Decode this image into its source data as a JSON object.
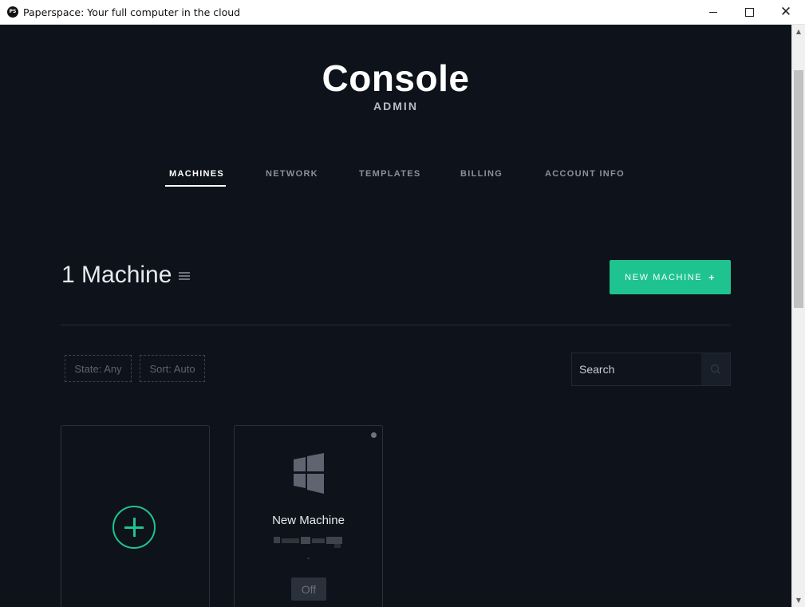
{
  "window": {
    "title": "Paperspace: Your full computer in the cloud",
    "app_icon_text": "PS",
    "close_glyph": "✕"
  },
  "header": {
    "title": "Console",
    "subtitle": "ADMIN"
  },
  "nav": {
    "tabs": [
      {
        "label": "MACHINES",
        "active": true
      },
      {
        "label": "NETWORK",
        "active": false
      },
      {
        "label": "TEMPLATES",
        "active": false
      },
      {
        "label": "BILLING",
        "active": false
      },
      {
        "label": "ACCOUNT INFO",
        "active": false
      }
    ]
  },
  "machines": {
    "count": "1",
    "count_label": "Machine",
    "new_button_label": "NEW MACHINE",
    "new_button_icon": "+",
    "filters": {
      "state": "State: Any",
      "sort": "Sort: Auto"
    },
    "search": {
      "placeholder": "Search",
      "icon": "search-icon"
    },
    "cards": [
      {
        "name": "New Machine",
        "os_icon": "windows-logo-icon",
        "detail": "-",
        "status": "Off"
      }
    ]
  },
  "colors": {
    "background": "#0e131b",
    "accent": "#1fc38f"
  }
}
